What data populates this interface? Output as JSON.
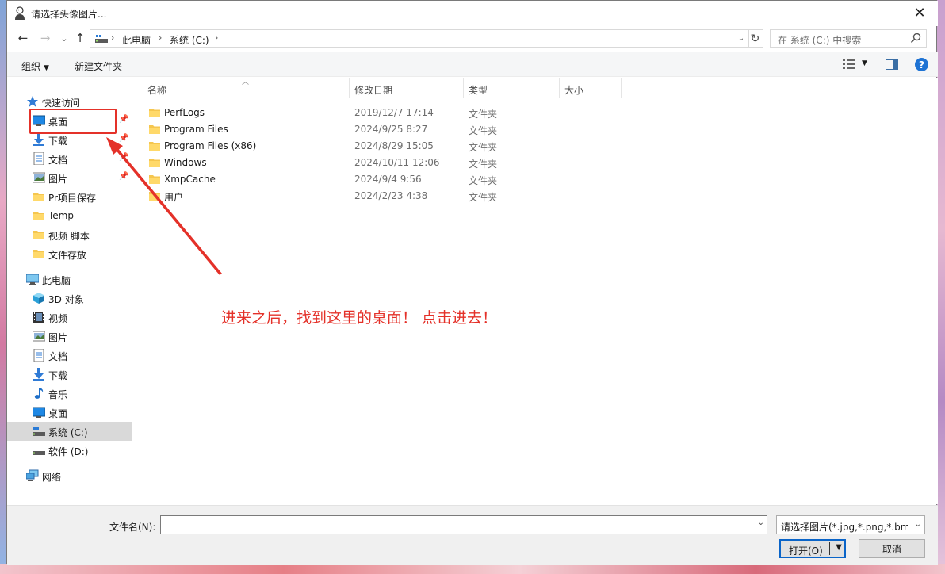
{
  "window": {
    "title": "请选择头像图片...",
    "close_label": "✕"
  },
  "nav": {
    "back": "←",
    "forward": "→",
    "recent": "⌄",
    "up": "↑",
    "breadcrumbs": [
      "此电脑",
      "系统 (C:)"
    ],
    "refresh": "↻",
    "search_placeholder": "在 系统 (C:) 中搜索"
  },
  "toolbar": {
    "organize": "组织",
    "new_folder": "新建文件夹",
    "help": "?"
  },
  "sidebar": {
    "quick_access": "快速访问",
    "quick_items": [
      "桌面",
      "下载",
      "文档",
      "图片",
      "Pr项目保存",
      "Temp",
      "视频 脚本",
      "文件存放"
    ],
    "this_pc": "此电脑",
    "pc_items": [
      "3D 对象",
      "视频",
      "图片",
      "文档",
      "下载",
      "音乐",
      "桌面",
      "系统 (C:)",
      "软件 (D:)"
    ],
    "network": "网络"
  },
  "columns": {
    "name": "名称",
    "date": "修改日期",
    "type": "类型",
    "size": "大小"
  },
  "files": [
    {
      "name": "PerfLogs",
      "date": "2019/12/7 17:14",
      "type": "文件夹"
    },
    {
      "name": "Program Files",
      "date": "2024/9/25 8:27",
      "type": "文件夹"
    },
    {
      "name": "Program Files (x86)",
      "date": "2024/8/29 15:05",
      "type": "文件夹"
    },
    {
      "name": "Windows",
      "date": "2024/10/11 12:06",
      "type": "文件夹"
    },
    {
      "name": "XmpCache",
      "date": "2024/9/4 9:56",
      "type": "文件夹"
    },
    {
      "name": "用户",
      "date": "2024/2/23 4:38",
      "type": "文件夹"
    }
  ],
  "footer": {
    "filename_label": "文件名(N):",
    "filename_value": "",
    "filter": "请选择图片(*.jpg,*.png,*.bmp,",
    "open": "打开(O)",
    "cancel": "取消"
  },
  "annotation": {
    "text": "进来之后，找到这里的桌面！ 点击进去！"
  },
  "colors": {
    "accent": "#0a64c8",
    "annotation": "#e43129",
    "folder": "#f5c64f",
    "selected": "#d9d9d9"
  }
}
